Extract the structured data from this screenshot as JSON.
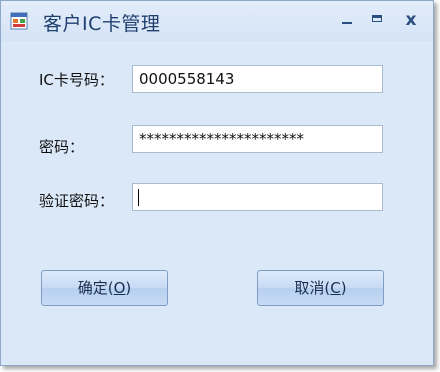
{
  "window": {
    "title": "客户IC卡管理"
  },
  "title_buttons": {
    "minimize": "–",
    "maximize": "□",
    "close": "x"
  },
  "form": {
    "card_label": "IC卡号码：",
    "card_value": "0000558143",
    "password_label": "密码：",
    "password_value": "**********************",
    "verify_label": "验证密码：",
    "verify_value": ""
  },
  "buttons": {
    "ok_label": "确定(",
    "ok_hotkey": "O",
    "ok_suffix": ")",
    "cancel_label": "取消(",
    "cancel_hotkey": "C",
    "cancel_suffix": ")"
  },
  "colors": {
    "window_bg": "#dbe8f8",
    "title_text": "#1f3f6e",
    "border": "#8fa8c8"
  },
  "icons": {
    "app": "form-app-icon"
  }
}
